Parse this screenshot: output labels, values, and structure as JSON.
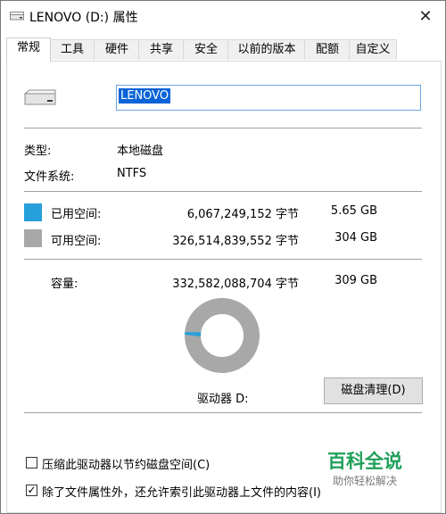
{
  "window": {
    "title": "LENOVO (D:) 属性",
    "close_glyph": "✕"
  },
  "tabs": [
    "常规",
    "工具",
    "硬件",
    "共享",
    "安全",
    "以前的版本",
    "配额",
    "自定义"
  ],
  "general": {
    "name_value": "LENOVO",
    "type_label": "类型:",
    "type_value": "本地磁盘",
    "fs_label": "文件系统:",
    "fs_value": "NTFS",
    "used": {
      "label": "已用空间:",
      "bytes": "6,067,249,152 字节",
      "size": "5.65 GB",
      "color": "#26a0da"
    },
    "free": {
      "label": "可用空间:",
      "bytes": "326,514,839,552 字节",
      "size": "304 GB",
      "color": "#a8a8a8"
    },
    "capacity": {
      "label": "容量:",
      "bytes": "332,582,088,704 字节",
      "size": "309 GB"
    },
    "usage_fraction": 0.0182,
    "drive_label": "驱动器 D:",
    "cleanup_button": "磁盘清理(D)",
    "compress_label": "压缩此驱动器以节约磁盘空间(C)",
    "compress_checked": false,
    "index_label": "除了文件属性外，还允许索引此驱动器上文件的内容(I)",
    "index_checked": true,
    "check_glyph": "✓"
  },
  "watermark": {
    "big": "百科全说",
    "small": "助你轻松解决"
  }
}
